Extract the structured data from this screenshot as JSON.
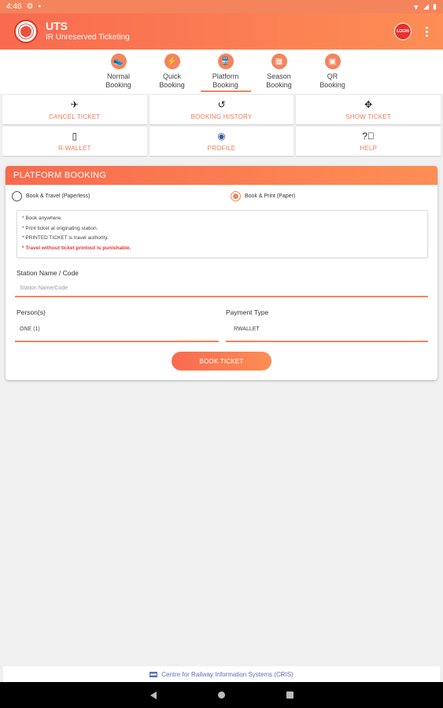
{
  "status_bar": {
    "time": "4:46"
  },
  "header": {
    "title": "UTS",
    "subtitle": "IR Unreserved Ticketing",
    "login_label": "LOGIN"
  },
  "tabs": [
    {
      "label": "Normal\nBooking",
      "icon": "shoe-icon"
    },
    {
      "label": "Quick\nBooking",
      "icon": "lightning-icon"
    },
    {
      "label": "Platform\nBooking",
      "icon": "train-icon",
      "active": true
    },
    {
      "label": "Season\nBooking",
      "icon": "season-ticket-icon"
    },
    {
      "label": "QR\nBooking",
      "icon": "qr-icon"
    }
  ],
  "actions": [
    {
      "label": "CANCEL TICKET",
      "icon": "cancel-ticket-icon"
    },
    {
      "label": "BOOKING HISTORY",
      "icon": "history-icon"
    },
    {
      "label": "SHOW TICKET",
      "icon": "show-ticket-icon"
    },
    {
      "label": "R-WALLET",
      "icon": "wallet-icon"
    },
    {
      "label": "PROFILE",
      "icon": "profile-icon"
    },
    {
      "label": "HELP",
      "icon": "help-icon"
    }
  ],
  "form": {
    "title": "PLATFORM BOOKING",
    "option_paperless": "Book & Travel (Paperless)",
    "option_paper": "Book & Print (Paper)",
    "selected_option": "paper",
    "notes": [
      "* Book anywhere.",
      "* Print ticket at originating station.",
      "* PRINTED TICKET is travel authority."
    ],
    "warning": "* Travel without ticket printout is punishable.",
    "station_label": "Station Name / Code",
    "station_placeholder": "Station Name/Code",
    "persons_label": "Person(s)",
    "persons_value": "ONE (1)",
    "payment_label": "Payment Type",
    "payment_value": "RWALLET",
    "submit_label": "BOOK TICKET"
  },
  "footer": {
    "text": "Centre for Railway Information Systems (CRIS)"
  },
  "colors": {
    "accent": "#f4845c",
    "warning": "#e53935",
    "footer_text": "#5a6fbf"
  }
}
